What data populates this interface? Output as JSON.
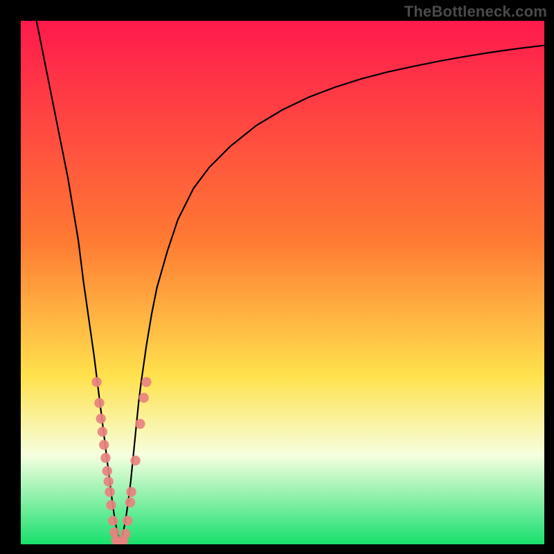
{
  "attribution": "TheBottleneck.com",
  "colors": {
    "gradient_top": "#ff1a4d",
    "gradient_orange": "#ff7a33",
    "gradient_yellow": "#ffe24d",
    "gradient_pale": "#f6ffe0",
    "gradient_green": "#18e06d",
    "curve": "#000000",
    "marker": "#e8827f",
    "frame": "#000000"
  },
  "chart_data": {
    "type": "line",
    "title": "",
    "xlabel": "",
    "ylabel": "",
    "xlim": [
      0,
      100
    ],
    "ylim": [
      0,
      100
    ],
    "x_optimum": 19,
    "series": [
      {
        "name": "bottleneck-curve",
        "x": [
          3,
          5,
          7,
          9,
          11,
          12,
          13,
          14,
          15,
          15.5,
          16,
          16.5,
          17,
          17.5,
          18,
          18.5,
          19,
          19.5,
          20,
          20.5,
          21,
          21.5,
          22,
          22.5,
          23,
          24,
          25,
          26,
          28,
          30,
          33,
          36,
          40,
          45,
          50,
          55,
          60,
          65,
          70,
          75,
          80,
          85,
          90,
          95,
          100
        ],
        "y": [
          100,
          90,
          80,
          70,
          58,
          50,
          43,
          36,
          28,
          24,
          20,
          16,
          12,
          8,
          4.5,
          2,
          0.5,
          2,
          4.5,
          8,
          12,
          17,
          22,
          27,
          31,
          38,
          44,
          49,
          56,
          62,
          68,
          72,
          76,
          80,
          83,
          85.4,
          87.3,
          88.9,
          90.2,
          91.3,
          92.3,
          93.2,
          94,
          94.7,
          95.3
        ]
      }
    ],
    "markers": {
      "name": "sample-points",
      "clusters": [
        {
          "x": 14.5,
          "y": 31
        },
        {
          "x": 15.0,
          "y": 27
        },
        {
          "x": 15.3,
          "y": 24
        },
        {
          "x": 15.6,
          "y": 21.5
        },
        {
          "x": 15.9,
          "y": 19
        },
        {
          "x": 16.2,
          "y": 16.5
        },
        {
          "x": 16.5,
          "y": 14
        },
        {
          "x": 16.75,
          "y": 12
        },
        {
          "x": 17.0,
          "y": 10
        },
        {
          "x": 17.25,
          "y": 7.5
        },
        {
          "x": 17.6,
          "y": 4.5
        },
        {
          "x": 17.9,
          "y": 2.3
        },
        {
          "x": 18.2,
          "y": 0.8
        },
        {
          "x": 18.5,
          "y": 0.3
        },
        {
          "x": 18.8,
          "y": 0.1
        },
        {
          "x": 19.0,
          "y": 0.0
        },
        {
          "x": 19.3,
          "y": 0.2
        },
        {
          "x": 19.6,
          "y": 0.7
        },
        {
          "x": 20.0,
          "y": 2.0
        },
        {
          "x": 20.4,
          "y": 4.5
        },
        {
          "x": 20.9,
          "y": 8.0
        },
        {
          "x": 21.1,
          "y": 10.0
        },
        {
          "x": 21.9,
          "y": 16.0
        },
        {
          "x": 22.8,
          "y": 23.0
        },
        {
          "x": 23.5,
          "y": 28.0
        },
        {
          "x": 24.0,
          "y": 31.0
        }
      ]
    },
    "background": {
      "type": "vertical-gradient",
      "stops": [
        {
          "pct": 0,
          "color": "#ff1a4d"
        },
        {
          "pct": 42,
          "color": "#ff7a33"
        },
        {
          "pct": 68,
          "color": "#ffe24d"
        },
        {
          "pct": 83,
          "color": "#f6ffe0"
        },
        {
          "pct": 100,
          "color": "#18e06d"
        }
      ]
    }
  }
}
